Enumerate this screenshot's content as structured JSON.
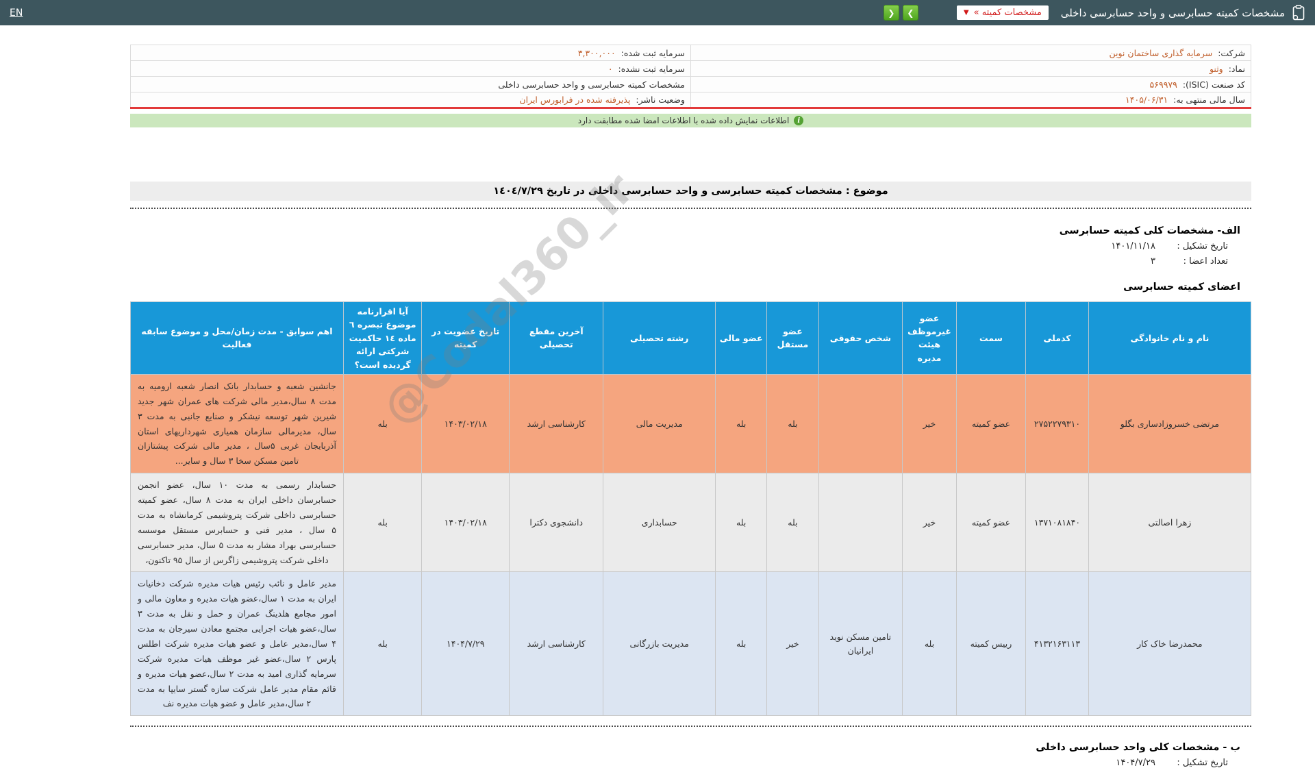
{
  "topbar": {
    "title": "مشخصات کمیته حسابرسی و واحد حسابرسی داخلی",
    "dropdown_label": "مشخصات کمیته »",
    "dropdown_caret": "▼",
    "next_glyph": "❯",
    "prev_glyph": "❮",
    "lang_link": "EN"
  },
  "info_table": {
    "rows": [
      {
        "right": {
          "label": "شرکت:",
          "value": "سرمایه گذاری ساختمان نوین"
        },
        "left": {
          "label": "سرمایه ثبت شده:",
          "value": "۳,۳۰۰,۰۰۰"
        }
      },
      {
        "right": {
          "label": "نماد:",
          "value": "وثنو"
        },
        "left": {
          "label": "سرمایه ثبت نشده:",
          "value": "۰"
        }
      },
      {
        "right": {
          "label": "کد صنعت (ISIC):",
          "value": "۵۶۹۹۷۹"
        },
        "left": {
          "label": "مشخصات کمیته حسابرسی و واحد حسابرسی داخلی",
          "value": ""
        }
      },
      {
        "right": {
          "label": "سال مالی منتهی به:",
          "value": "۱۴۰۵/۰۶/۳۱"
        },
        "left": {
          "label": "وضعیت ناشر:",
          "value": "پذیرفته شده در فرابورس ایران"
        }
      }
    ]
  },
  "signature_notice": "اطلاعات نمایش داده شده با اطلاعات امضا شده مطابقت دارد",
  "notice_icon_glyph": "i",
  "subject": "موضوع : مشخصات کمیته حسابرسی و واحد حسابرسی داخلی در تاریخ ١٤٠٤/٧/٢٩",
  "section_a": {
    "title": "الف- مشخصات کلی کمیته حسابرسی",
    "formation_date_label": "تاریخ تشکیل :",
    "formation_date": "۱۴۰۱/۱۱/۱۸",
    "members_count_label": "تعداد اعضا :",
    "members_count": "۳",
    "members_title": "اعضای کمیته حسابرسی"
  },
  "members_table": {
    "headers": [
      "نام و نام خانوادگی",
      "کدملی",
      "سمت",
      "عضو غیرموظف هیئت مدیره",
      "شخص حقوقی",
      "عضو مستقل",
      "عضو مالی",
      "رشته تحصیلی",
      "آخرین مقطع تحصیلی",
      "تاریخ عضویت در کمیته",
      "آیا اقرارنامه موضوع تبصره ٦ ماده ١٤ حاکمیت شرکتی ارائه گردیده است؟",
      "اهم سوابق - مدت زمان/محل و موضوع سابقه فعالیت"
    ],
    "rows": [
      {
        "name": "مرتضی خسروزادساری بگلو",
        "national_id": "۲۷۵۲۲۷۹۳۱۰",
        "position": "عضو کمیته",
        "non_executive_board_member": "خیر",
        "legal_entity": "",
        "independent_member": "بله",
        "financial_member": "بله",
        "study_field": "مدیریت مالی",
        "last_degree": "کارشناسی ارشد",
        "membership_date": "۱۴۰۳/۰۲/۱۸",
        "declaration_provided": "بله",
        "background": "جانشین شعبه و حسابدار بانک انصار شعبه ارومیه به مدت ۸ سال،مدیر مالی شرکت های عمران شهر جدید شیرین شهر توسعه نیشکر و صنایع جانبی به مدت ۳ سال، مدیرمالی سازمان همیاری شهرداریهای استان آذربایجان غربی ۵سال ، مدیر مالی شرکت پیشتازان تامین مسکن سخا ۳ سال و سایر..."
      },
      {
        "name": "زهرا اصالتی",
        "national_id": "۱۳۷۱۰۸۱۸۴۰",
        "position": "عضو کمیته",
        "non_executive_board_member": "خیر",
        "legal_entity": "",
        "independent_member": "بله",
        "financial_member": "بله",
        "study_field": "حسابداری",
        "last_degree": "دانشجوی دکترا",
        "membership_date": "۱۴۰۳/۰۲/۱۸",
        "declaration_provided": "بله",
        "background": "حسابدار رسمی به مدت ۱۰ سال، عضو انجمن حسابرسان داخلی ایران به مدت ۸ سال، عضو کمیته حسابرسی داخلی شرکت پتروشیمی کرمانشاه به مدت ۵ سال ، مدیر فنی و حسابرس مستقل موسسه حسابرسی بهراد مشار به مدت ۵ سال، مدیر حسابرسی داخلی شرکت پتروشیمی زاگرس از سال ۹۵ تاکنون،"
      },
      {
        "name": "محمدرضا خاک کار",
        "national_id": "۴۱۳۲۱۶۳۱۱۳",
        "position": "رییس کمیته",
        "non_executive_board_member": "بله",
        "legal_entity": "تامین مسکن نوید ایرانیان",
        "independent_member": "خیر",
        "financial_member": "بله",
        "study_field": "مدیریت بازرگانی",
        "last_degree": "کارشناسی ارشد",
        "membership_date": "۱۴۰۴/۷/۲۹",
        "declaration_provided": "بله",
        "background": "مدیر عامل و نائب رئیس هیات مدیره شرکت دخانیات ایران به مدت ۱ سال،عضو هیات مدیره و معاون مالی و امور مجامع هلدینگ عمران و حمل و نقل به مدت ۳ سال،عضو هیات اجرایی مجتمع معادن سیرجان به مدت ۴ سال،مدیر عامل و عضو هیات مدیره شرکت اطلس پارس ۲ سال،عضو غیر موظف هیات مدیره شرکت سرمایه گذاری امید به مدت ۲ سال،عضو هیات مدیره و قائم مقام مدیر عامل شرکت سازه گستر سایپا به مدت ۲ سال،مدیر عامل و عضو هیات مدیره نف"
      }
    ]
  },
  "section_b": {
    "title": "ب - مشخصات کلی واحد حسابرسی داخلی",
    "formation_date_label": "تاریخ تشکیل :",
    "formation_date": "۱۴۰۴/۷/۲۹"
  },
  "watermark": "@Codal360_ir",
  "colors": {
    "topbar_bg": "#3d565e",
    "accent_link": "#c05e2b",
    "alert_line": "#e23a3a",
    "notice_bg": "#cbe7bd",
    "notice_icon": "#54a233",
    "table_header_bg": "#1898d8",
    "row_member1_bg": "#f5a57f",
    "row_member2_bg": "#ebebeb",
    "row_member3_bg": "#dce5f2",
    "dropdown_text": "#d11a1a"
  }
}
